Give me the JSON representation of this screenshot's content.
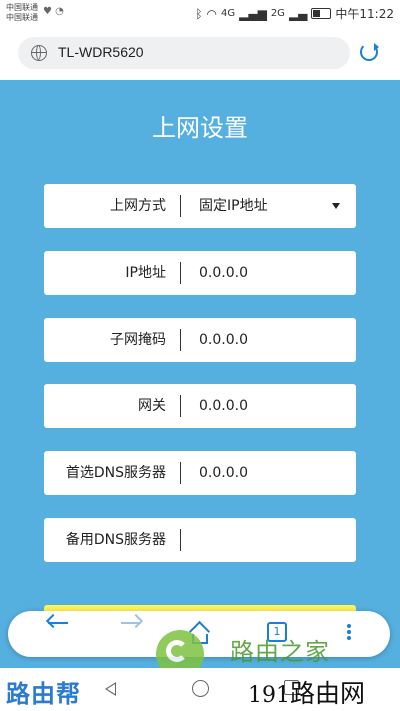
{
  "status_bar": {
    "carrier_1": "中国联通",
    "carrier_2": "中国联通",
    "signal_4g": "4G",
    "signal_2g": "2G",
    "time": "中午11:22"
  },
  "browser": {
    "url": "TL-WDR5620",
    "tab_count": "1"
  },
  "page": {
    "title": "上网设置",
    "fields": [
      {
        "label": "上网方式",
        "value": "固定IP地址"
      },
      {
        "label": "IP地址",
        "value": "0.0.0.0"
      },
      {
        "label": "子网掩码",
        "value": "0.0.0.0"
      },
      {
        "label": "网关",
        "value": "0.0.0.0"
      },
      {
        "label": "首选DNS服务器",
        "value": "0.0.0.0"
      },
      {
        "label": "备用DNS服务器",
        "value": ""
      }
    ],
    "save_button_color": "#fff35a",
    "background_color": "#55b0e0"
  },
  "watermarks": {
    "center": "路由之家",
    "left": "路由帮",
    "right_number": "191",
    "right_text": "路由网"
  }
}
